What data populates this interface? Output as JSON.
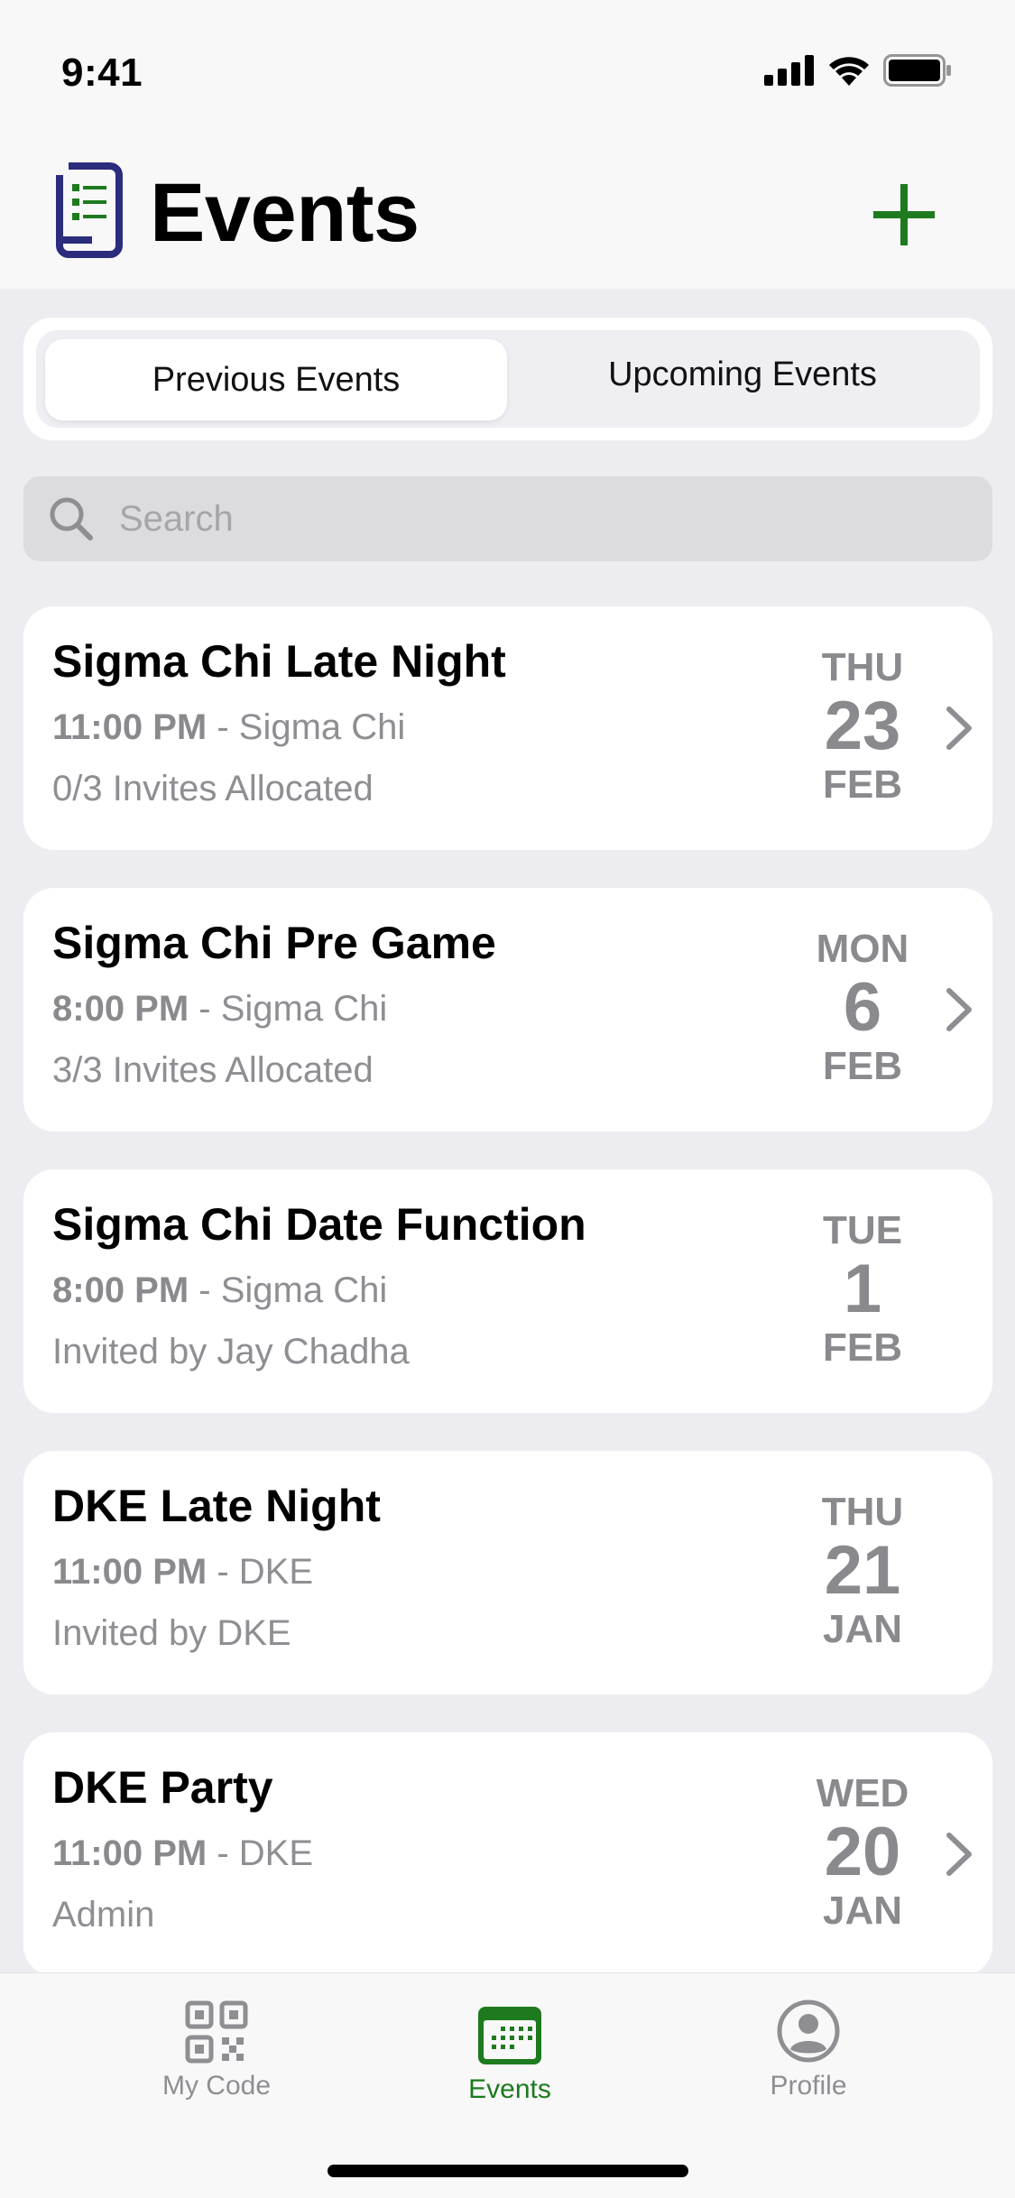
{
  "status_bar": {
    "time": "9:41"
  },
  "header": {
    "title": "Events"
  },
  "segments": {
    "selected": "Previous Events",
    "other": "Upcoming Events"
  },
  "search": {
    "placeholder": "Search",
    "value": ""
  },
  "events": [
    {
      "title": "Sigma Chi Late Night",
      "time": "11:00 PM",
      "separator": " - ",
      "host": "Sigma Chi",
      "detail": "0/3 Invites Allocated",
      "dow": "THU",
      "day": "23",
      "month": "FEB",
      "has_chevron": true
    },
    {
      "title": "Sigma Chi Pre Game",
      "time": "8:00 PM",
      "separator": " - ",
      "host": "Sigma Chi",
      "detail": "3/3 Invites Allocated",
      "dow": "MON",
      "day": "6",
      "month": "FEB",
      "has_chevron": true
    },
    {
      "title": "Sigma Chi Date Function",
      "time": "8:00 PM",
      "separator": " - ",
      "host": "Sigma Chi",
      "detail": "Invited by Jay Chadha",
      "dow": "TUE",
      "day": "1",
      "month": "FEB",
      "has_chevron": false
    },
    {
      "title": "DKE Late Night",
      "time": "11:00 PM",
      "separator": " - ",
      "host": "DKE",
      "detail": "Invited by DKE",
      "dow": "THU",
      "day": "21",
      "month": "JAN",
      "has_chevron": false
    },
    {
      "title": "DKE Party",
      "time": "11:00 PM",
      "separator": " - ",
      "host": "DKE",
      "detail": "Admin",
      "dow": "WED",
      "day": "20",
      "month": "JAN",
      "has_chevron": true
    }
  ],
  "tab_bar": {
    "my_code": {
      "label": "My Code",
      "icon": "qr-code-icon"
    },
    "events": {
      "label": "Events",
      "icon": "calendar-icon"
    },
    "profile": {
      "label": "Profile",
      "icon": "person-circle-icon"
    }
  },
  "colors": {
    "accent": "#1E7A1E",
    "logo": "#2B2C7C",
    "gray_text": "#8E8E93",
    "background": "#EDEDF1"
  }
}
